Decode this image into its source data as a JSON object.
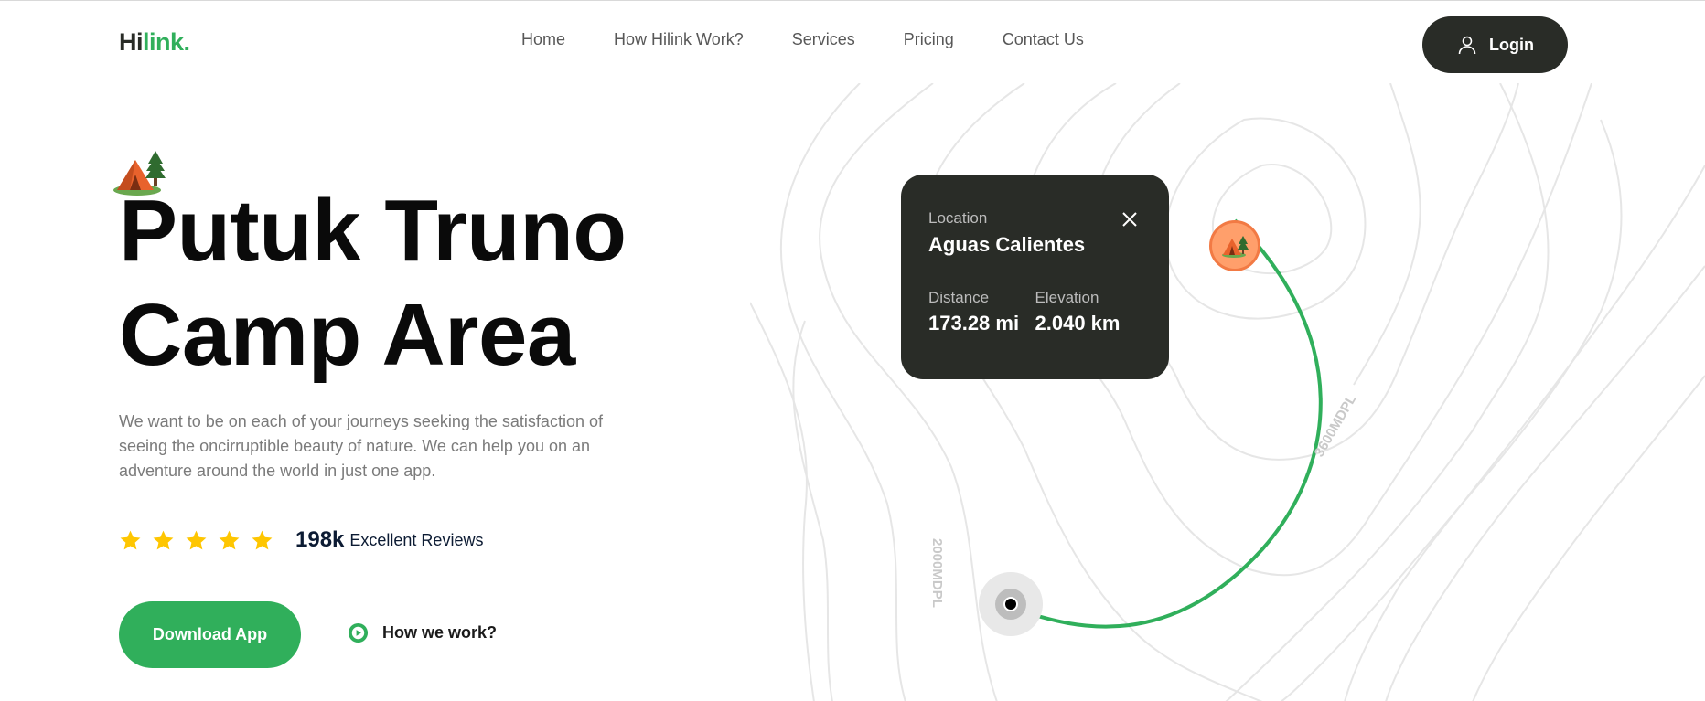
{
  "brand": {
    "logo_dark": "Hi",
    "logo_accent": "link.",
    "accent_color": "#30af5b",
    "dark_color": "#292c27"
  },
  "nav": {
    "links": [
      "Home",
      "How Hilink Work?",
      "Services",
      "Pricing",
      "Contact Us"
    ],
    "login_label": "Login",
    "login_icon": "user-icon"
  },
  "hero": {
    "badge_icon": "camping-tent-icon",
    "title_line1": "Putuk Truno",
    "title_line2": "Camp Area",
    "description": "We want to be on each of your journeys seeking the satisfaction of seeing the oncirruptible beauty of nature. We can help you on an adventure around the world in just one app.",
    "rating_stars": 5,
    "review_count": "198k",
    "review_text": "Excellent Reviews",
    "download_label": "Download App",
    "how_label": "How we work?"
  },
  "map": {
    "card": {
      "location_label": "Location",
      "location_value": "Aguas Calientes",
      "distance_label": "Distance",
      "distance_value": "173.28 mi",
      "elevation_label": "Elevation",
      "elevation_value": "2.040 km"
    },
    "contour_label_1": "2000MDPL",
    "contour_label_2": "3600MDPL",
    "route_color": "#30af5b",
    "pin_color": "#ff9f6b"
  }
}
